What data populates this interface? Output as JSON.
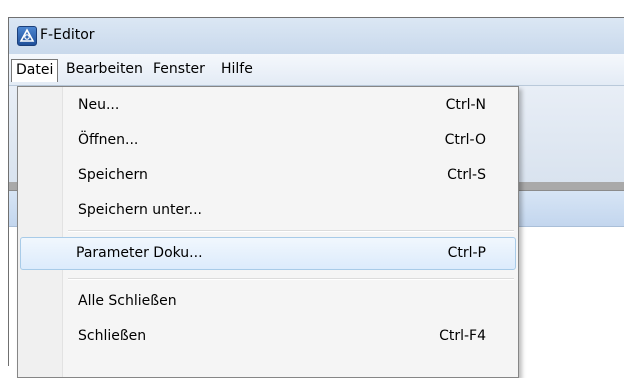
{
  "window": {
    "title": "F-Editor",
    "icon": "app-logo-icon"
  },
  "menubar": {
    "items": [
      {
        "label": "Datei",
        "open": true
      },
      {
        "label": "Bearbeiten"
      },
      {
        "label": "Fenster"
      },
      {
        "label": "Hilfe"
      }
    ]
  },
  "dropdown": {
    "items": [
      {
        "label": "Neu...",
        "shortcut": "Ctrl-N"
      },
      {
        "label": "Öffnen...",
        "shortcut": "Ctrl-O"
      },
      {
        "label": "Speichern",
        "shortcut": "Ctrl-S"
      },
      {
        "label": "Speichern unter...",
        "shortcut": ""
      },
      {
        "label": "Parameter Doku...",
        "shortcut": "Ctrl-P",
        "highlighted": true
      },
      {
        "label": "Alle Schließen",
        "shortcut": ""
      },
      {
        "label": "Schließen",
        "shortcut": "Ctrl-F4"
      }
    ]
  },
  "colors": {
    "highlight_border": "#a8cbe8",
    "titlebar": "#c9d9ec"
  }
}
